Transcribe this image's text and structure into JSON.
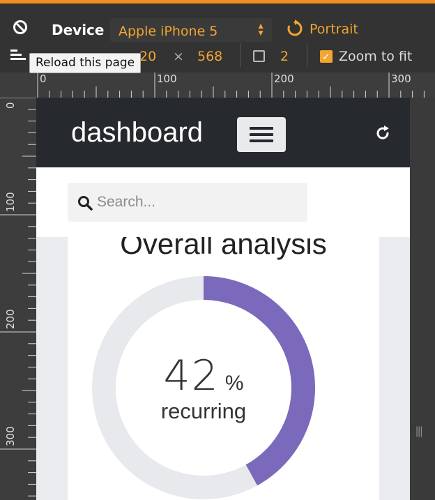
{
  "devtools": {
    "device_label": "Device",
    "device_value": "Apple iPhone 5",
    "orientation_label": "Portrait",
    "tooltip": "Reload this page",
    "width_value": "20",
    "times_sign": "×",
    "height_value": "568",
    "dpr_value": "2",
    "zoom_label": "Zoom to fit",
    "zoom_checked": true
  },
  "rulers": {
    "top_labels": [
      "0",
      "100",
      "200",
      "300"
    ],
    "left_labels": [
      "0",
      "100",
      "200",
      "300"
    ]
  },
  "page": {
    "brand": "dashboard",
    "search": {
      "placeholder": "Search..."
    },
    "card": {
      "title": "Overall analysis",
      "percent_value": "42",
      "percent_sign": "%",
      "caption": "recurring",
      "progress_fraction": 0.42,
      "colors": {
        "fill": "#7b69bb",
        "track": "#e7e9ec"
      }
    }
  },
  "icons": [
    "no-entry-icon",
    "rotate-icon",
    "lines-icon",
    "dpr-icon",
    "hamburger-icon",
    "refresh-icon",
    "search-icon",
    "resize-grip-icon"
  ]
}
